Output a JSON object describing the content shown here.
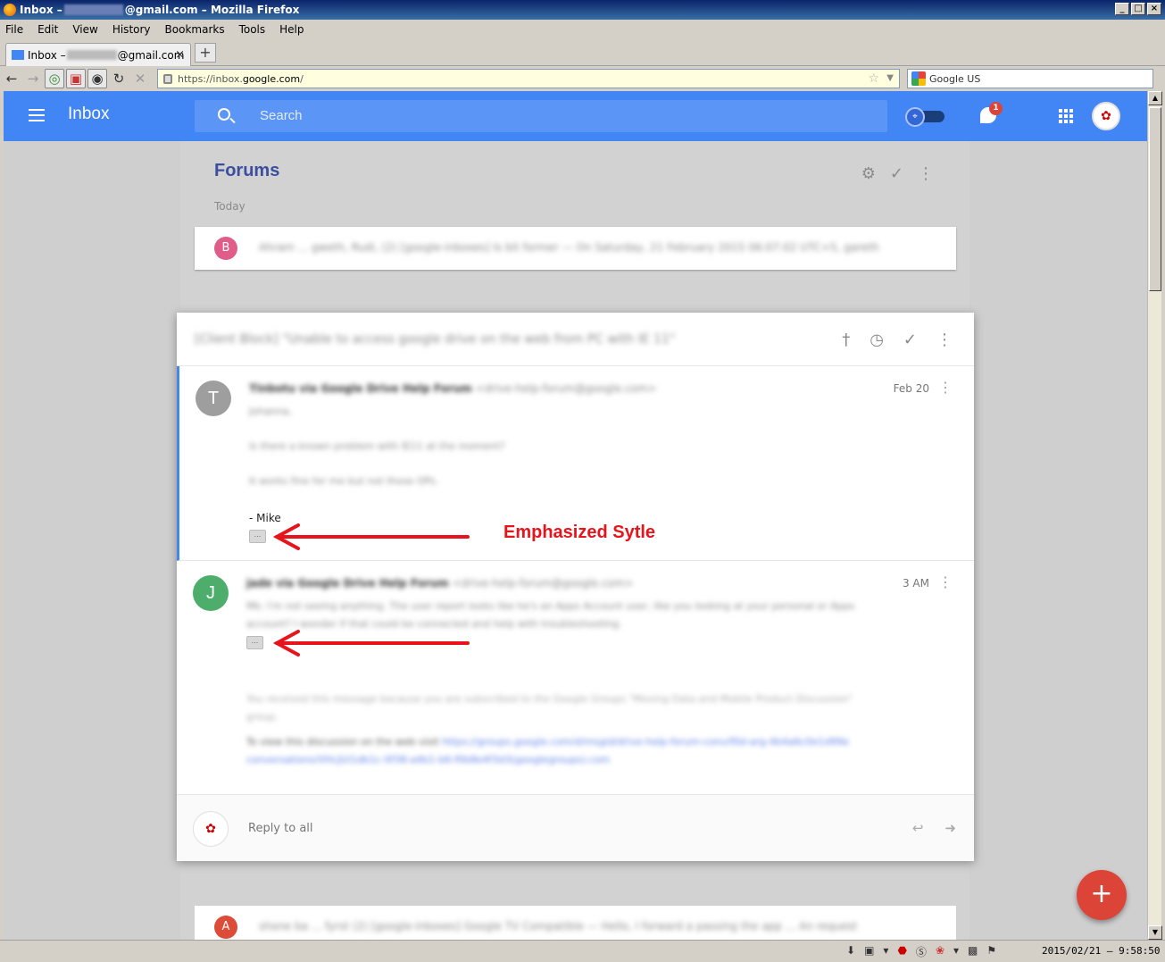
{
  "window": {
    "title_prefix": "Inbox –",
    "title_suffix": "@gmail.com – Mozilla Firefox",
    "min": "_",
    "max": "□",
    "close": "×"
  },
  "menu": [
    "File",
    "Edit",
    "View",
    "History",
    "Bookmarks",
    "Tools",
    "Help"
  ],
  "tab": {
    "title_prefix": "Inbox –",
    "title_suffix": "@gmail.com",
    "close": "×",
    "new_tab": "+"
  },
  "nav": {
    "url_prefix": "https://inbox.",
    "url_host": "google.com",
    "url_suffix": "/",
    "search_engine": "Google US"
  },
  "app": {
    "title": "Inbox",
    "search_placeholder": "Search",
    "notification_count": "1",
    "accent": "#4285f4"
  },
  "bundle": {
    "title": "Forums",
    "section": "Today",
    "row_b_initial": "B",
    "row_b_text": "Ahram ... gweth, Rudi, (2) [google-inboxes] Is bit former — On Saturday, 21 February 2015 06:07:02 UTC+5, gareth",
    "row_a_initial": "A",
    "row_a_text": "shone ba ... fyrst (2)   [google-inboxes] Google TV Compatible — Hello, I forward a passing the app ... An request"
  },
  "thread": {
    "subject": "[Client Block] \"Unable to access google drive on the web from PC with IE 11\"",
    "messages": [
      {
        "initial": "T",
        "sender": "Tinbotu via Google Drive Help Forum",
        "sender_detail": "<drive-help-forum@google.com>",
        "date": "Feb 20",
        "line1": "Johanna,",
        "line2": "Is there a known problem with IE11 at the moment?",
        "line3": "It works fine for me but not those OPs.",
        "signature": "- Mike",
        "more_label": "..."
      },
      {
        "initial": "J",
        "sender": "jade via Google Drive Help Forum",
        "sender_detail": "<drive-help-forum@google.com>",
        "date": "3 AM",
        "line1": "Mk: I'm not seeing anything. The user report looks like he's an Apps Account user, like you looking at your personal or Apps",
        "line2": "account? I wonder if that could be connected and help with troubleshooting.",
        "more_label": "...",
        "footer1": "You received this message because you are subscribed to the Google Groups \"Moving Data and Mobile Product Discussion\"",
        "footer2": "group.",
        "view_text": "To view this discussion on the web visit",
        "view_link": "https://groups.google.com/d/msgid/drive-help-forum-conv/f0d-arg-4b4a6c0e1d99e",
        "view_link2": "conversations/VHcJUi1db1c-0f38-a4b1-b6-f0b8e4f3d3(googlegroups).com"
      }
    ],
    "reply_label": "Reply to all"
  },
  "annotation": {
    "label": "Emphasized Sytle",
    "color": "#e8141c"
  },
  "status": {
    "clock": "2015/02/21 – 9:58:50"
  }
}
